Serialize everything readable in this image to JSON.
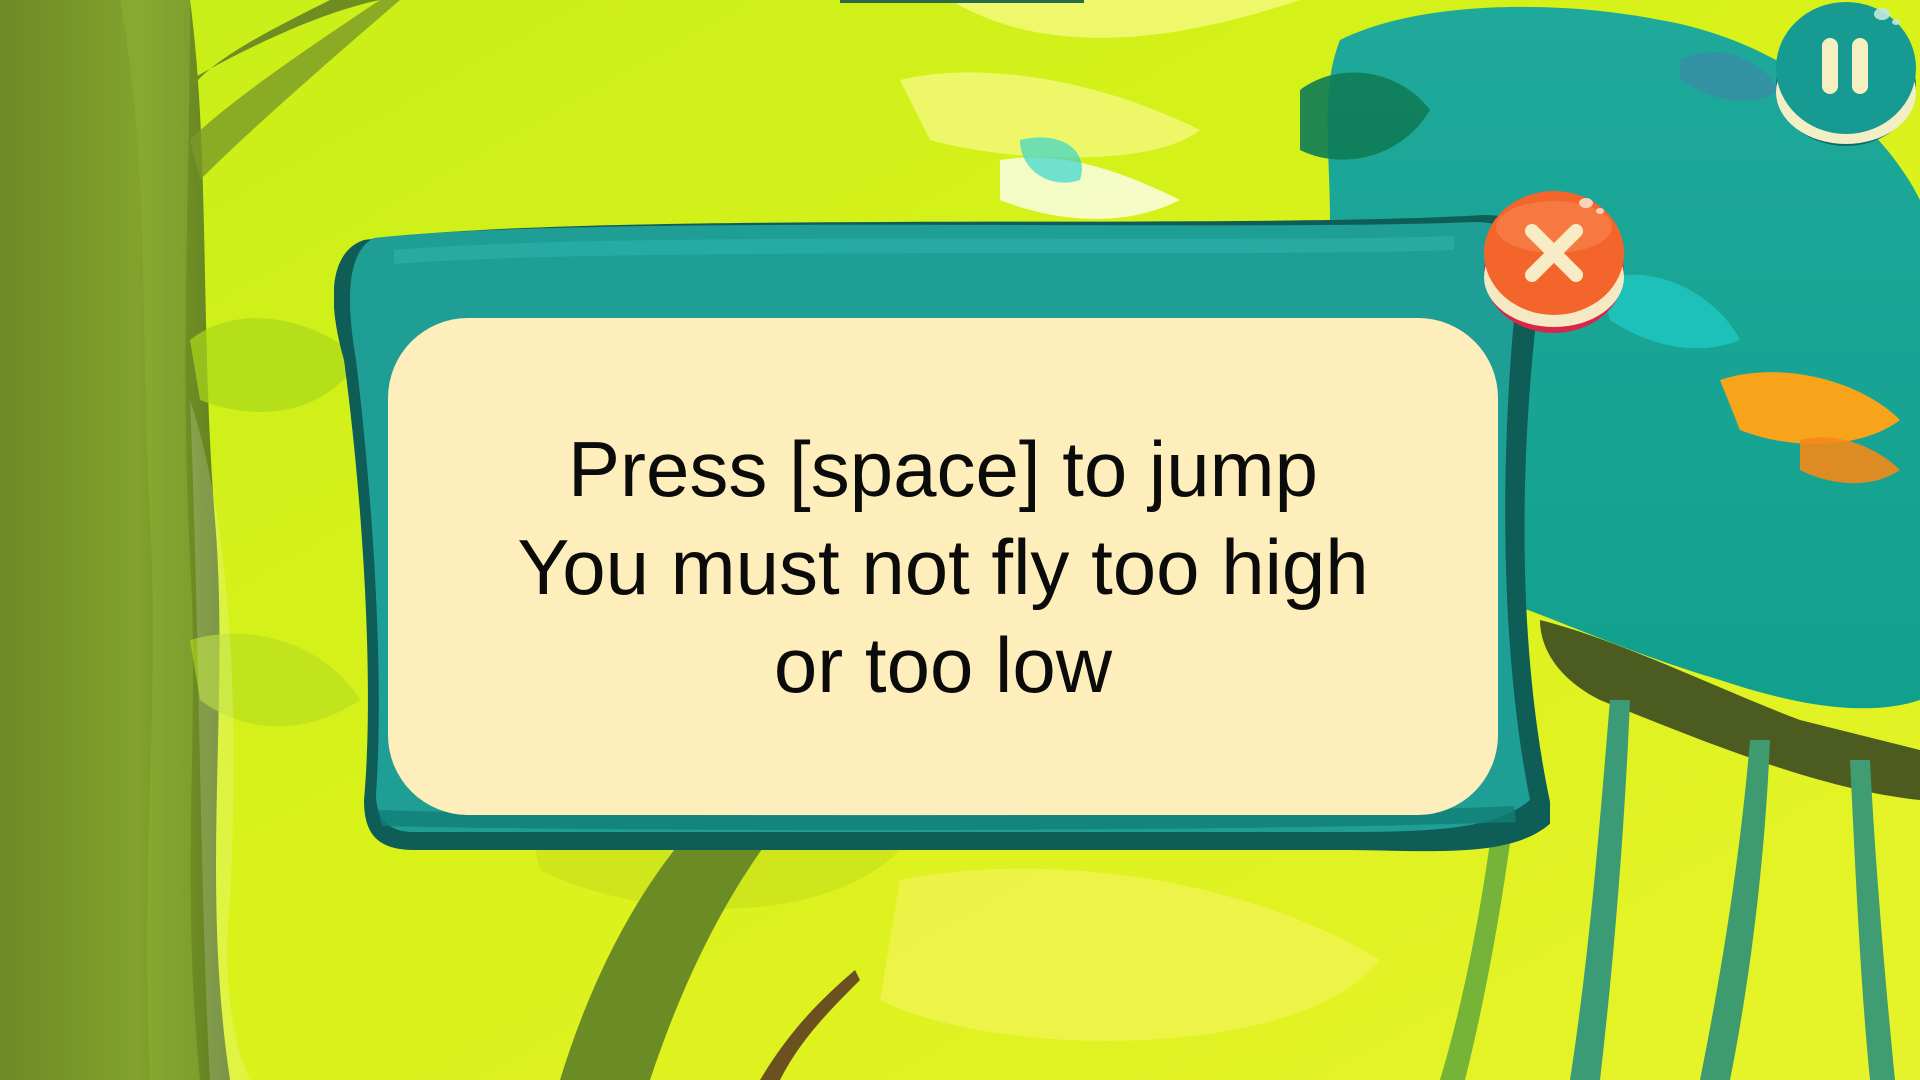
{
  "dialog": {
    "lines": [
      "Press [space] to jump",
      "You must not fly too high",
      "or too low"
    ]
  },
  "icons": {
    "pause": "pause-icon",
    "close": "close-icon"
  },
  "colors": {
    "dialog_frame": "#1f9e96",
    "dialog_frame_dark": "#0e5e57",
    "dialog_panel": "#fdeebb",
    "close_button": "#f3652a",
    "close_button_shadow": "#d8264a",
    "pause_button": "#169a92",
    "text": "#0b0b0b"
  }
}
